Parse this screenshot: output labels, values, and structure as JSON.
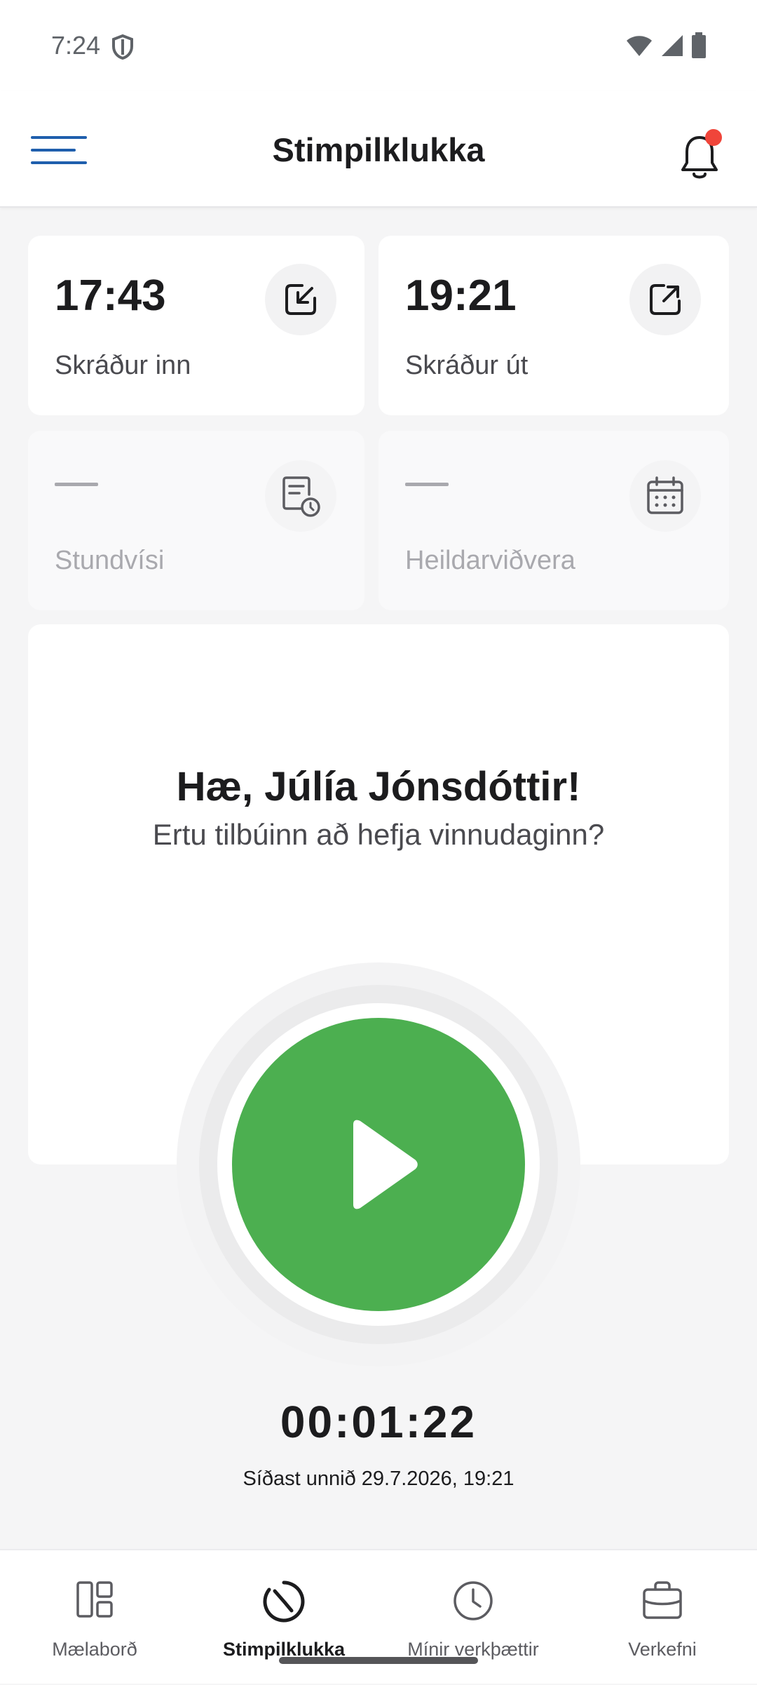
{
  "status_bar": {
    "time": "7:24"
  },
  "header": {
    "title": "Stimpilklukka",
    "has_notification": true
  },
  "stats": [
    {
      "value": "17:43",
      "label": "Skráður inn",
      "icon": "clock-in-arrow-icon"
    },
    {
      "value": "19:21",
      "label": "Skráður út",
      "icon": "clock-out-arrow-icon"
    },
    {
      "value": "—",
      "label": "Stundvísi",
      "icon": "punctuality-icon"
    },
    {
      "value": "—",
      "label": "Heildarviðvera",
      "icon": "calendar-icon"
    }
  ],
  "greeting": {
    "title": "Hæ, Júlía Jónsdóttir!",
    "subtitle": "Ertu tilbúinn að hefja vinnudaginn?"
  },
  "timer": {
    "elapsed": "00:01:22",
    "last_worked": "Síðast unnið 29.7.2026, 19:21"
  },
  "nav": {
    "items": [
      {
        "label": "Mælaborð",
        "icon": "dashboard-icon"
      },
      {
        "label": "Stimpilklukka",
        "icon": "clock-icon"
      },
      {
        "label": "Mínir verkþættir",
        "icon": "history-clock-icon"
      },
      {
        "label": "Verkefni",
        "icon": "briefcase-icon"
      }
    ],
    "active": "Stimpilklukka"
  },
  "colors": {
    "primary": "#1f5fad",
    "play": "#4caf50",
    "notification": "#f0453a"
  }
}
